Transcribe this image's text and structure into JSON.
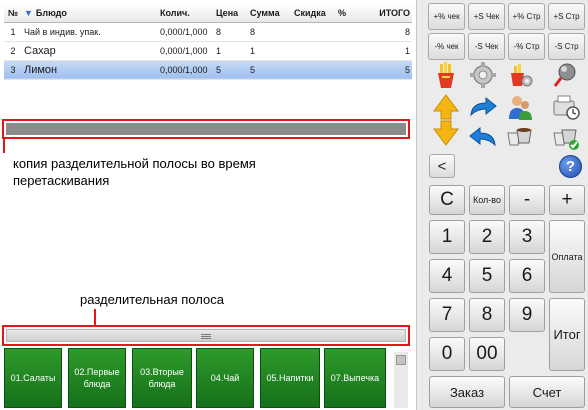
{
  "order": {
    "columns": {
      "num": "№",
      "dish": "Блюдо",
      "qty": "Колич.",
      "price": "Цена",
      "sum": "Сумма",
      "discount": "Скидка",
      "percent": "%",
      "total": "ИТОГО"
    },
    "rows": [
      {
        "num": "1",
        "dish": "Чай в индив. упак.",
        "qty": "0,000/1,000",
        "price": "8",
        "sum": "8",
        "discount": "",
        "percent": "",
        "total": "8"
      },
      {
        "num": "2",
        "dish": "Сахар",
        "qty": "0,000/1,000",
        "price": "1",
        "sum": "1",
        "discount": "",
        "percent": "",
        "total": "1"
      },
      {
        "num": "3",
        "dish": "Лимон",
        "qty": "0,000/1,000",
        "price": "5",
        "sum": "5",
        "discount": "",
        "percent": "",
        "total": "5"
      }
    ]
  },
  "annotations": {
    "drag_copy_line1": "копия разделительной полосы во время",
    "drag_copy_line2": "перетаскивания",
    "divider_label": "разделительная полоса"
  },
  "categories": [
    "01.Салаты",
    "02.Первые блюда",
    "03.Вторые блюда",
    "04.Чай",
    "05.Напитки",
    "07.Выпечка"
  ],
  "discount_buttons": {
    "pct_check_plus": "+% чек",
    "sum_check_plus": "+S Чек",
    "pct_line_plus": "+% Стр",
    "sum_line_plus": "+S Стр",
    "pct_check_minus": "-% чек",
    "sum_check_minus": "-S Чек",
    "pct_line_minus": "-% Стр",
    "sum_line_minus": "-S Стр"
  },
  "nav": {
    "back": "<",
    "help": "?"
  },
  "keypad": {
    "clear": "C",
    "quantity": "Кол-во",
    "minus": "-",
    "plus": "+",
    "k1": "1",
    "k2": "2",
    "k3": "3",
    "k4": "4",
    "k5": "5",
    "k6": "6",
    "k7": "7",
    "k8": "8",
    "k9": "9",
    "k0": "0",
    "k00": "00",
    "pay": "Оплата",
    "total": "Итог",
    "order": "Заказ",
    "bill": "Счет"
  },
  "colors": {
    "selected_row": "#9ebfee",
    "highlight_border": "#e8141c",
    "category_green": "#1e8a22"
  }
}
